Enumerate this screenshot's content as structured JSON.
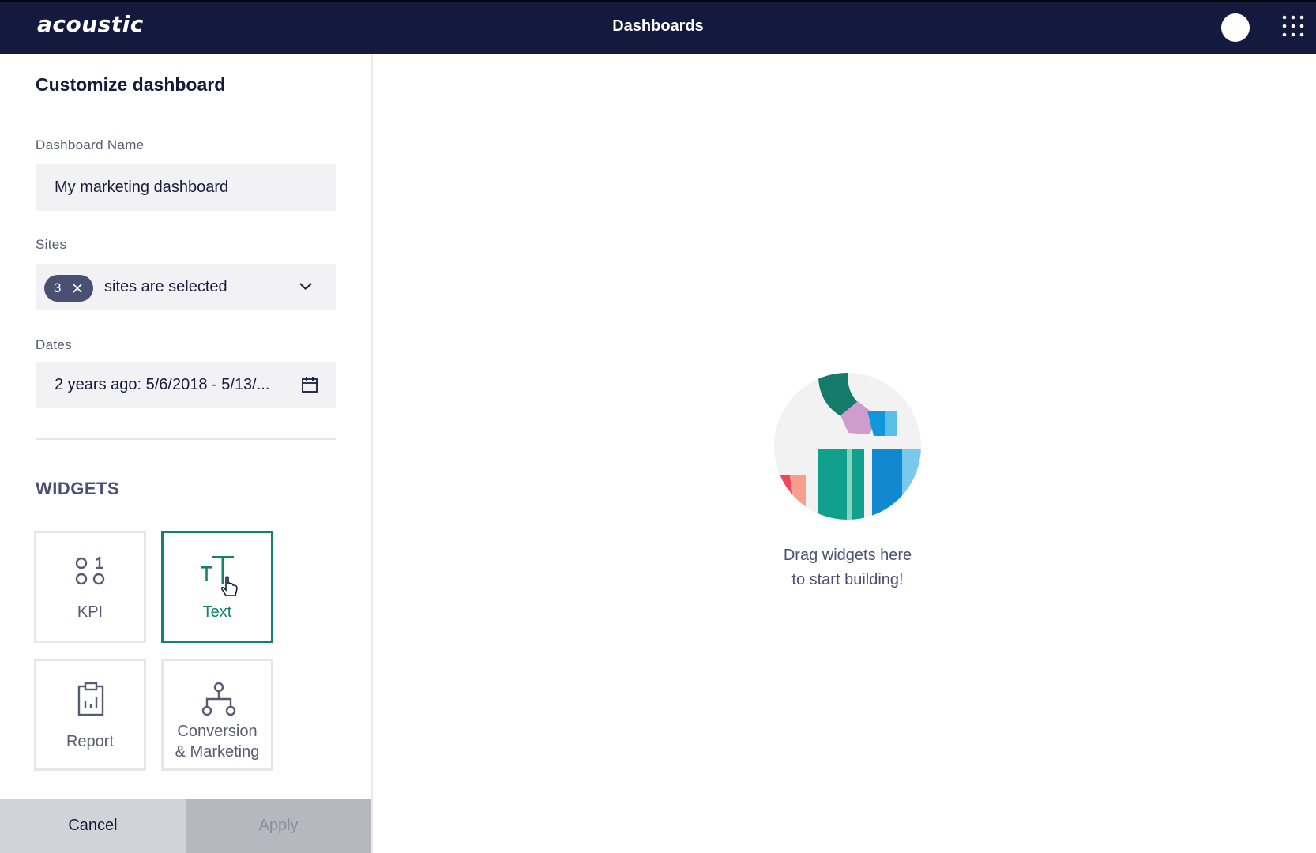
{
  "header": {
    "logo": "acoustic",
    "title": "Dashboards"
  },
  "panel": {
    "title": "Customize dashboard",
    "dashboard_name": {
      "label": "Dashboard Name",
      "value": "My marketing dashboard"
    },
    "sites": {
      "label": "Sites",
      "selected_count": "3",
      "value": "sites are selected"
    },
    "dates": {
      "label": "Dates",
      "value": "2 years ago: 5/6/2018 - 5/13/..."
    },
    "widgets": {
      "heading": "WIDGETS",
      "items": [
        {
          "label": "KPI",
          "icon": "kpi-icon",
          "selected": false
        },
        {
          "label": "Text",
          "icon": "text-icon",
          "selected": true
        },
        {
          "label": "Report",
          "icon": "report-icon",
          "selected": false
        },
        {
          "label_line1": "Conversion",
          "label_line2": "& Marketing",
          "icon": "conversion-icon",
          "selected": false
        }
      ]
    },
    "footer": {
      "cancel_label": "Cancel",
      "apply_label": "Apply"
    }
  },
  "canvas": {
    "empty_line1": "Drag widgets here",
    "empty_line2": "to start building!"
  },
  "colors": {
    "header_bg": "#141a3d",
    "accent": "#16806e",
    "chip_bg": "#4a5072"
  }
}
